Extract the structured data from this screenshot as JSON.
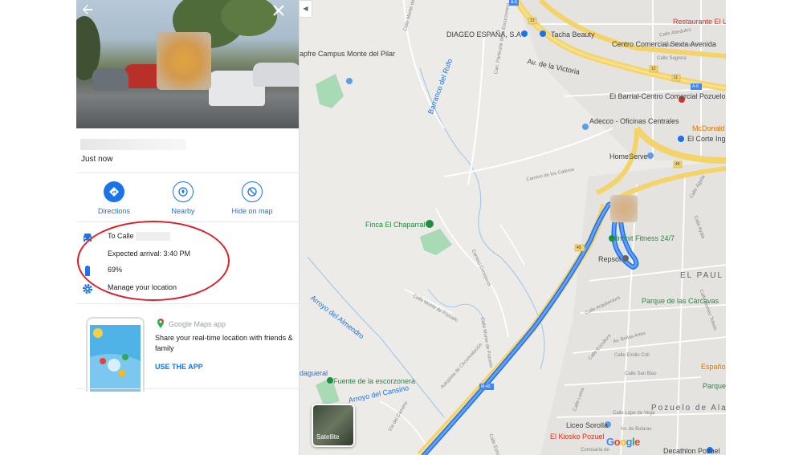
{
  "panel": {
    "time_ago": "Just now",
    "actions": [
      {
        "label": "Directions"
      },
      {
        "label": "Nearby"
      },
      {
        "label": "Hide on map"
      }
    ],
    "info": {
      "destination_prefix": "To Calle",
      "arrival": "Expected arrival: 3:40 PM",
      "battery": "69%",
      "manage": "Manage your location"
    },
    "promo": {
      "app_name": "Google Maps app",
      "text": "Share your real-time location with friends & family",
      "cta": "USE THE APP"
    }
  },
  "map": {
    "labels": {
      "diageo": "DIAGEO ESPAÑA, S.A",
      "tacha": "Tacha Beauty",
      "centro_comercial": "Centro Comercial Sexta Avenida",
      "av_victoria": "Av. de la Victoria",
      "restaurante": "Restaurante El L",
      "el_barrial": "El Barrial-Centro Comercial Pozuelo",
      "adecco": "Adecco - Oficinas Centrales",
      "mcdonalds": "McDonald",
      "corte_ingles": "El Corte Inglé",
      "homeserve": "HomeServe",
      "campus": "apfre Campus Monte del Pilar",
      "barranco": "Barranco del Rufo",
      "finca": "Finca El Chaparral",
      "infinit": "Infinit Fitness 24/7",
      "repsol": "Repsol",
      "el_paul": "EL PAUL",
      "parque_carcavas": "Parque de las Cárcavas",
      "arroyo_almendro": "Arroyo del Almendro",
      "fuente": "Fuente de la escorzonera",
      "arroyo_cansino": "Arroyo del Cansino",
      "dagueral": "dagueral",
      "espanola": "Español",
      "parque_t": "Parque de T",
      "pozuelo": "Pozuelo de Alarcón",
      "liceo": "Liceo Sorolla",
      "kiosko": "El Kiosko Pozuel",
      "decathlon": "Decathlon Pozuel",
      "comisaria": "Comisaría de",
      "m40": "M-40",
      "a6": "A-6",
      "exit45": "45",
      "exit13": "13",
      "exit12": "12",
      "exit11": "11",
      "calle_monte_pilar": "Calle Monte del Pilar",
      "camino_caleros": "Camino de los Caleros",
      "camino_conejeros": "Camino Conejeros",
      "calle_monte_pozuelo": "Calle Monte de Pozuelo",
      "calle_arquitectura": "Calle Arquitectura",
      "av_bellas_artes": "Av. Bellas Artes",
      "calle_emilio": "Calle Emilio Coll",
      "calle_escultura": "Calle Escultura",
      "calle_san_blas": "Calle San Blas",
      "av_bularas": "Av. de Bularas",
      "calle_lope": "Calle Lope de Vega",
      "autopista": "Autopista de Circunvalación",
      "carr_particular": "Carr. Particular de la Escorzonera",
      "calle_abedules": "Calle Abedules",
      "calle_amorebieta": "Calle Amorebieta",
      "calle_sagrera": "Calle Sagrera",
      "calle_aguila": "Calle Águila",
      "calle_estradas": "Calle Estradas",
      "calle_loma": "Calle Loma",
      "calle_ayala": "Calle Ayala",
      "calle_gomez": "Calle Gomez Toledo",
      "via_cansino": "Vía del Cansino",
      "calle_monte_pozuelo_2": "Calle Monte de Pozuelo"
    },
    "satellite_label": "Satellite",
    "google_logo": "Google"
  },
  "colors": {
    "accent": "#1a73e8",
    "route": "#4a90e2",
    "highway": "#f5d36b",
    "annotation": "#d9222a",
    "park": "#a8dab5"
  }
}
